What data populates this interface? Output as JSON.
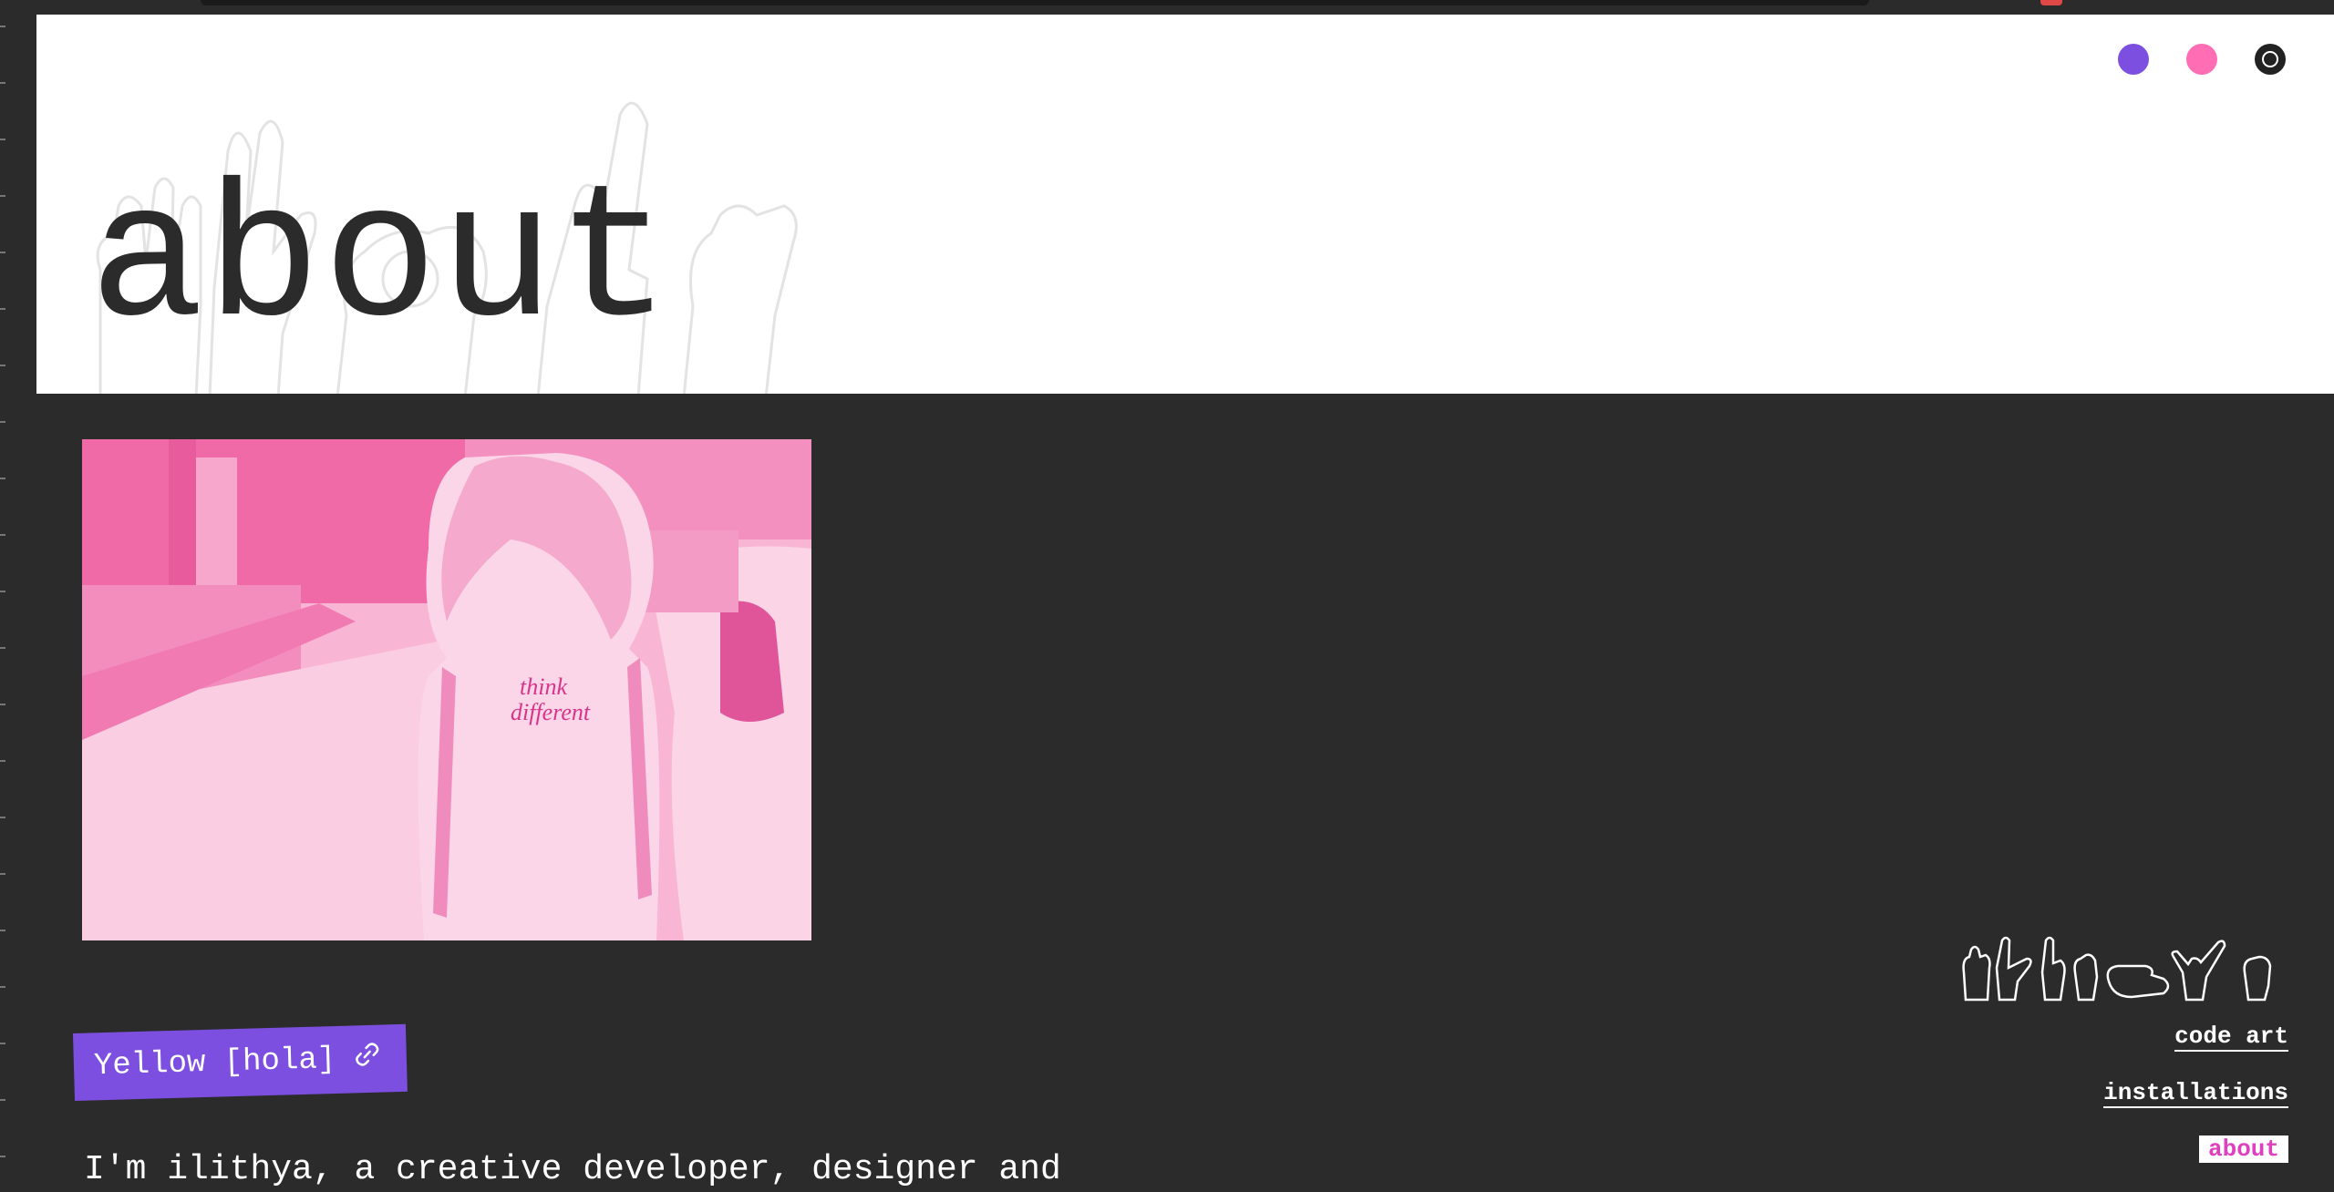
{
  "header": {
    "title": "about",
    "theme_dots": [
      {
        "name": "purple",
        "color": "#7c4fe0"
      },
      {
        "name": "pink",
        "color": "#ff6eb4"
      },
      {
        "name": "dark",
        "color": "#222222"
      }
    ]
  },
  "photo": {
    "shirt_text_line1": "think",
    "shirt_text_line2": "different"
  },
  "tag": {
    "label": "Yellow [hola]",
    "icon": "link-icon"
  },
  "intro": {
    "text": "I'm ilithya, a creative developer, designer and"
  },
  "nav": {
    "items": [
      {
        "label": "code art",
        "active": false
      },
      {
        "label": "installations",
        "active": false
      },
      {
        "label": "about",
        "active": true
      }
    ]
  },
  "colors": {
    "accent_purple": "#7c4fe0",
    "accent_pink": "#ff6eb4",
    "active_nav_text": "#e040c0",
    "background": "#2b2b2b"
  }
}
